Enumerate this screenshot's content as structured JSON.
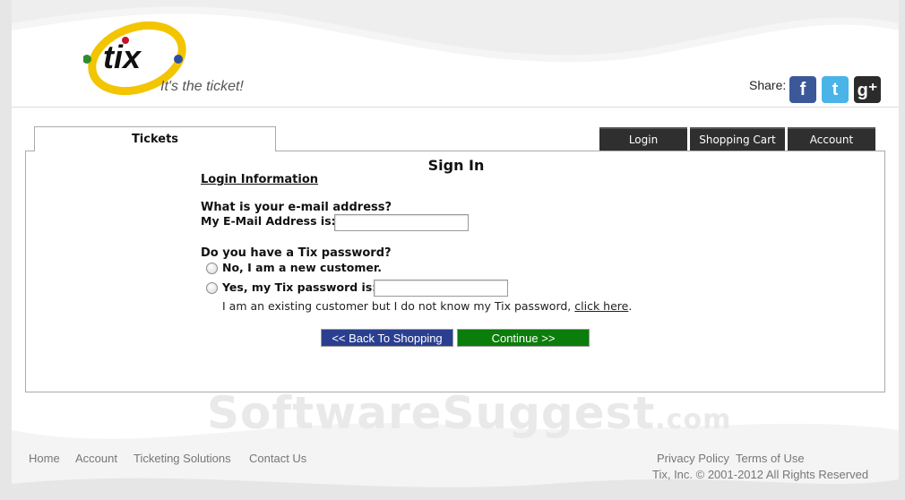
{
  "header": {
    "logo_text": "tix",
    "tagline": "It's the ticket!",
    "share_label": "Share:",
    "social": [
      "facebook-icon",
      "twitter-icon",
      "google-plus-icon"
    ]
  },
  "tabs": {
    "tickets": "Tickets"
  },
  "nav": {
    "login": "Login",
    "cart": "Shopping Cart",
    "account": "Account"
  },
  "form": {
    "title": "Sign In",
    "section": "Login Information",
    "email_question": "What is your e-mail address?",
    "email_label": "My E-Mail Address is:",
    "email_value": "",
    "password_question": "Do you have a Tix password?",
    "option_new": "No, I am a new customer.",
    "option_existing": "Yes, my Tix password is:",
    "password_value": "",
    "forgot_text": "I am an existing customer but I do not know my Tix password,",
    "forgot_link": "click here",
    "forgot_end": ".",
    "back_button": "<< Back To Shopping",
    "continue_button": "Continue >>"
  },
  "watermark": {
    "main": "SoftwareSuggest",
    "suffix": ".com"
  },
  "footer": {
    "links": [
      "Home",
      "Account",
      "Ticketing Solutions",
      "Contact Us"
    ],
    "privacy": "Privacy Policy",
    "terms": "Terms of Use",
    "copyright": "Tix, Inc. © 2001-2012 All Rights Reserved"
  },
  "colors": {
    "nav_bg": "#2f2f2f",
    "back_button": "#2a3f8f",
    "continue_button": "#0b7d0b",
    "logo_yellow": "#f2c500",
    "logo_red": "#c8102e"
  }
}
